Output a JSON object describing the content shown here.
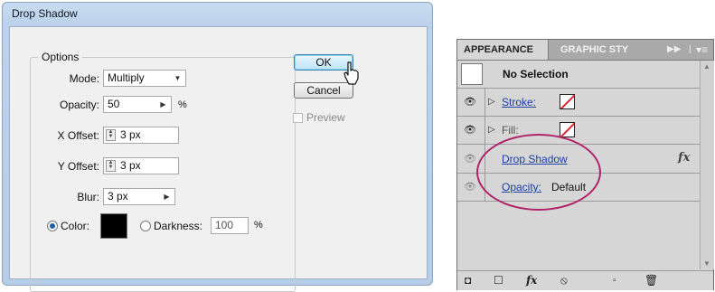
{
  "dialog": {
    "title": "Drop Shadow",
    "options_legend": "Options",
    "mode": {
      "label": "Mode:",
      "value": "Multiply"
    },
    "opacity": {
      "label": "Opacity:",
      "value": "50",
      "unit": "%"
    },
    "x_offset": {
      "label": "X Offset:",
      "value": "3 px"
    },
    "y_offset": {
      "label": "Y Offset:",
      "value": "3 px"
    },
    "blur": {
      "label": "Blur:",
      "value": "3 px"
    },
    "color": {
      "label": "Color:",
      "selected": true,
      "swatch": "#000000"
    },
    "darkness": {
      "label": "Darkness:",
      "value": "100",
      "unit": "%",
      "selected": false
    },
    "ok_label": "OK",
    "cancel_label": "Cancel",
    "preview_label": "Preview",
    "preview_checked": false
  },
  "appearance_panel": {
    "tabs": [
      {
        "label": "APPEARANCE",
        "active": true
      },
      {
        "label": "GRAPHIC STY",
        "active": false
      }
    ],
    "selection_label": "No Selection",
    "rows": [
      {
        "label": "Stroke:",
        "swatch": "none"
      },
      {
        "label": "Fill:",
        "swatch": "none"
      },
      {
        "label": "Drop Shadow",
        "effect_icon": "fx"
      },
      {
        "label": "Opacity:",
        "value": "Default"
      }
    ],
    "fx_glyph": "fx",
    "accent_highlight": "#b0246a"
  }
}
